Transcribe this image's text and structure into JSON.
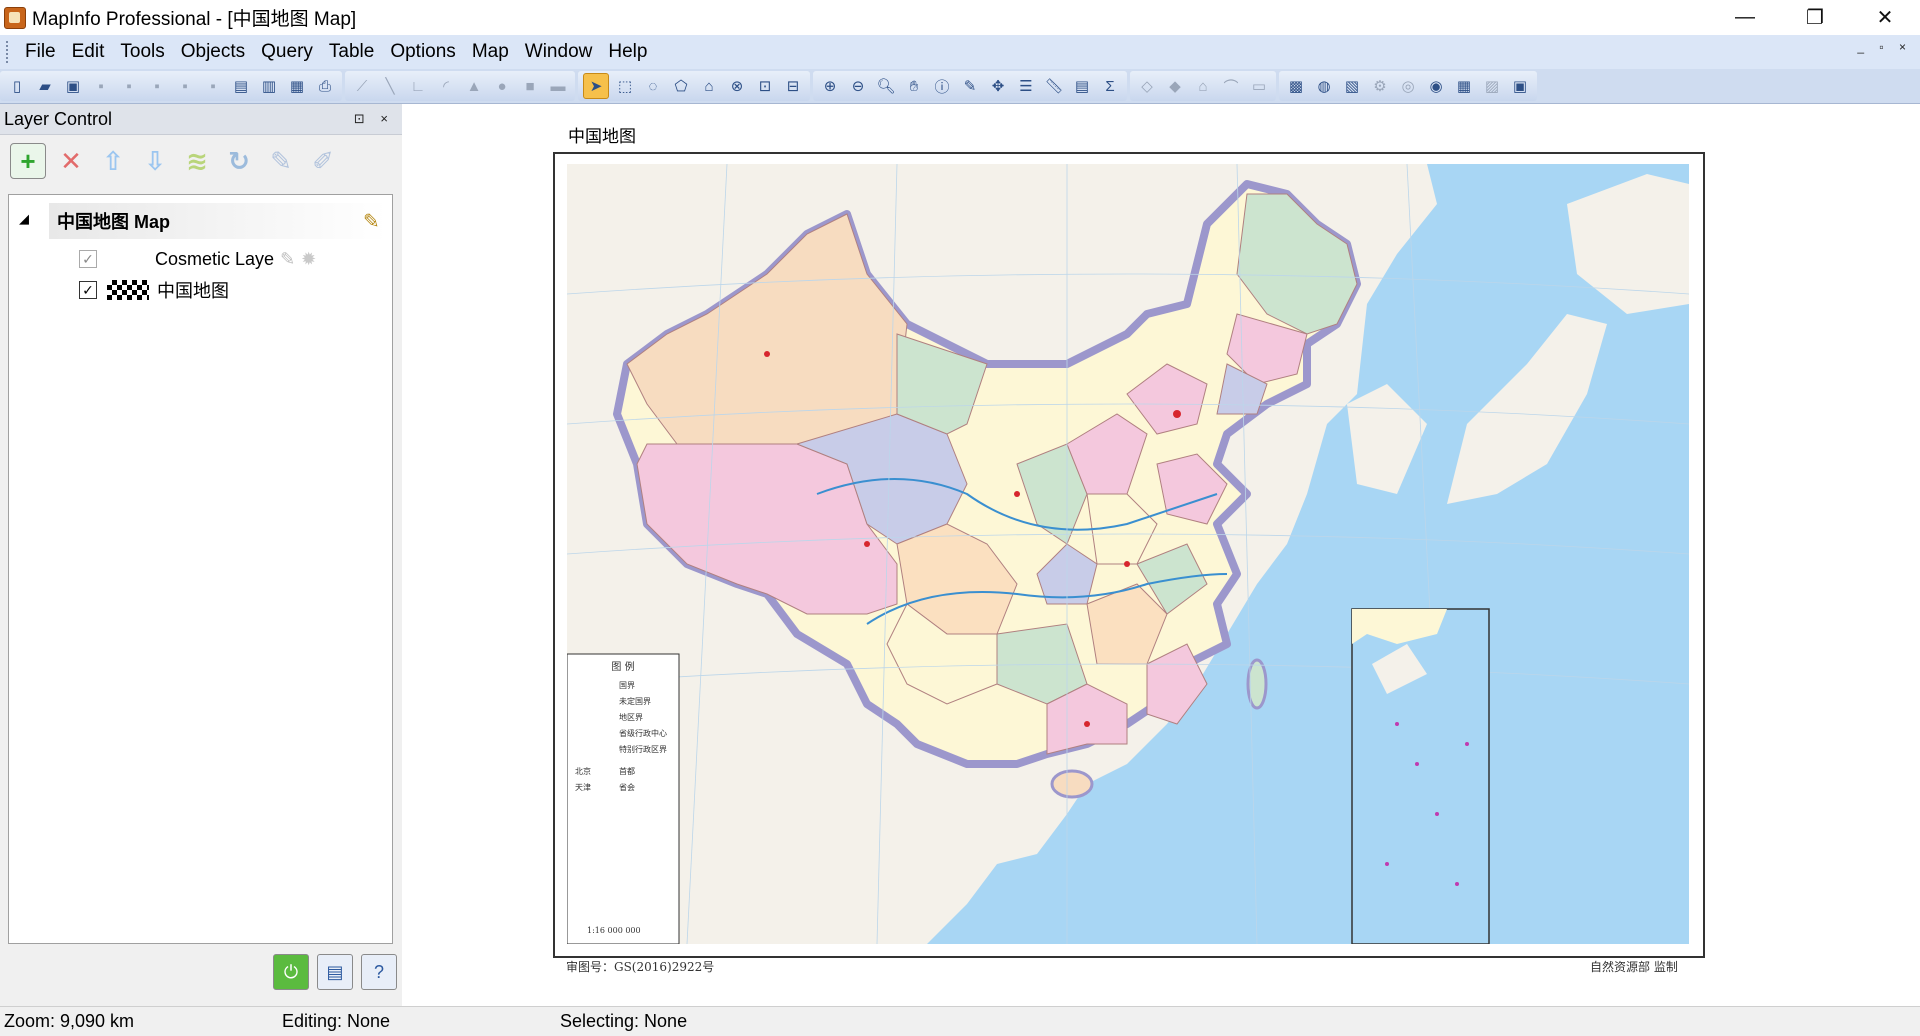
{
  "window": {
    "title": "MapInfo Professional - [中国地图 Map]",
    "controls": [
      "—",
      "❐",
      "✕"
    ]
  },
  "menubar": {
    "items": [
      "File",
      "Edit",
      "Tools",
      "Objects",
      "Query",
      "Table",
      "Options",
      "Map",
      "Window",
      "Help"
    ],
    "mdi_controls": "_ ▫ ×"
  },
  "toolbar": {
    "groups": [
      [
        "new-document",
        "open-folder",
        "open-workspace",
        "save",
        "save-copy",
        "save-query",
        "export",
        "save-workspace",
        "close",
        "open-dbms",
        "print-setup",
        "print"
      ],
      [
        "polyline",
        "line",
        "polyline2",
        "arc",
        "polygon",
        "ellipse",
        "rectangle",
        "rounded-rectangle"
      ],
      [
        "select-arrow",
        "marquee-select",
        "radius-select",
        "polygon-select",
        "boundary-select",
        "invert-select",
        "unselect",
        "graph-select"
      ],
      [
        "zoom-in",
        "zoom-out",
        "change-view",
        "grabber",
        "info",
        "label",
        "drag-window",
        "layer-control",
        "ruler",
        "legend",
        "statistics"
      ],
      [
        "reshape",
        "add-node",
        "symbol-style",
        "line-style",
        "region-style"
      ],
      [
        "open-universal",
        "world-globe",
        "map-view",
        "tools",
        "layers",
        "google-earth",
        "layout",
        "clip",
        "image"
      ]
    ],
    "selected": "select-arrow"
  },
  "layer_control": {
    "title": "Layer Control",
    "header_controls": "⊡ ×",
    "buttons": [
      "add-layer",
      "remove-layer",
      "move-up",
      "move-down",
      "reorder",
      "refresh",
      "display-options",
      "label-options"
    ],
    "map_name": "中国地图 Map",
    "layers": [
      {
        "name": "Cosmetic Laye",
        "checked": true,
        "dimmed": true
      },
      {
        "name": "中国地图",
        "checked": true,
        "dimmed": false
      }
    ],
    "bottom_buttons": [
      "apply-button",
      "layer-props",
      "help"
    ]
  },
  "map_document": {
    "title": "中国地图",
    "approval_number": "审图号：GS(2016)2922号",
    "publisher": "自然资源部 监制",
    "legend_title": "图  例",
    "scale_text": "1:16 000 000",
    "legend_items": [
      "国界",
      "未定国界",
      "地区界",
      "省级行政中心",
      "特别行政区界",
      "北京",
      "天津",
      "首都",
      "省会"
    ]
  },
  "statusbar": {
    "zoom": "Zoom: 9,090 km",
    "editing": "Editing: None",
    "selecting": "Selecting: None"
  },
  "colors": {
    "menubar_bg": "#dbe6f7",
    "toolbar_bg": "#cfdcf0",
    "sea": "#a8d6f4",
    "xinjiang": "#f7dcc0",
    "tibet": "#f4c8dd",
    "qinghai": "#c8cce8",
    "inner_mongolia": "#fdf7d6",
    "border_purple": "#9c97cc"
  }
}
